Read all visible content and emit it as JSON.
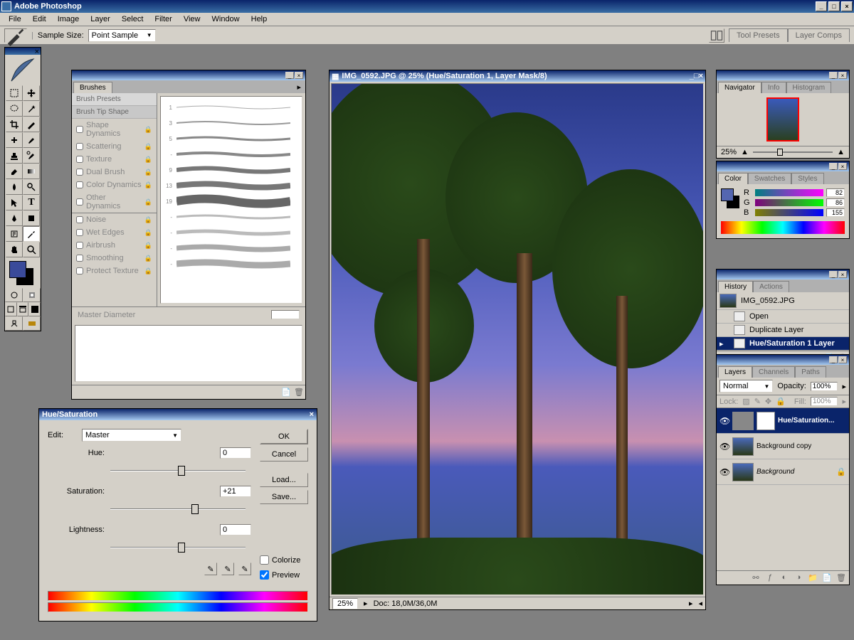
{
  "app": {
    "title": "Adobe Photoshop"
  },
  "menu": [
    "File",
    "Edit",
    "Image",
    "Layer",
    "Select",
    "Filter",
    "View",
    "Window",
    "Help"
  ],
  "options": {
    "sample_label": "Sample Size:",
    "sample_value": "Point Sample",
    "tabs": [
      "Tool Presets",
      "Layer Comps"
    ]
  },
  "brushes": {
    "title": "Brushes",
    "presets_label": "Brush Presets",
    "tip_label": "Brush Tip Shape",
    "options": [
      "Shape Dynamics",
      "Scattering",
      "Texture",
      "Dual Brush",
      "Color Dynamics",
      "Other Dynamics"
    ],
    "options2": [
      "Noise",
      "Wet Edges",
      "Airbrush",
      "Smoothing",
      "Protect Texture"
    ],
    "sizes": [
      "1",
      "3",
      "5",
      "-",
      "9",
      "13",
      "19",
      "-",
      "-",
      "-",
      "-"
    ],
    "master_label": "Master Diameter"
  },
  "document": {
    "title": "IMG_0592.JPG @ 25% (Hue/Saturation 1, Layer Mask/8)",
    "zoom": "25%",
    "doc_size": "Doc: 18,0M/36,0M"
  },
  "hs": {
    "title": "Hue/Saturation",
    "edit_label": "Edit:",
    "edit_value": "Master",
    "hue_label": "Hue:",
    "hue_value": "0",
    "sat_label": "Saturation:",
    "sat_value": "+21",
    "light_label": "Lightness:",
    "light_value": "0",
    "ok": "OK",
    "cancel": "Cancel",
    "load": "Load...",
    "save": "Save...",
    "colorize": "Colorize",
    "preview": "Preview"
  },
  "navigator": {
    "tabs": [
      "Navigator",
      "Info",
      "Histogram"
    ],
    "zoom": "25%"
  },
  "color": {
    "tabs": [
      "Color",
      "Swatches",
      "Styles"
    ],
    "r": "82",
    "g": "86",
    "b": "155"
  },
  "history": {
    "tabs": [
      "History",
      "Actions"
    ],
    "snapshot": "IMG_0592.JPG",
    "items": [
      "Open",
      "Duplicate Layer",
      "Hue/Saturation 1 Layer"
    ]
  },
  "layers": {
    "tabs": [
      "Layers",
      "Channels",
      "Paths"
    ],
    "blend": "Normal",
    "opacity_label": "Opacity:",
    "opacity": "100%",
    "lock_label": "Lock:",
    "fill_label": "Fill:",
    "fill": "100%",
    "items": [
      {
        "name": "Hue/Saturation...",
        "selected": true,
        "adjust": true
      },
      {
        "name": "Background copy",
        "selected": false,
        "adjust": false
      },
      {
        "name": "Background",
        "selected": false,
        "adjust": false,
        "locked": true,
        "italic": true
      }
    ]
  }
}
